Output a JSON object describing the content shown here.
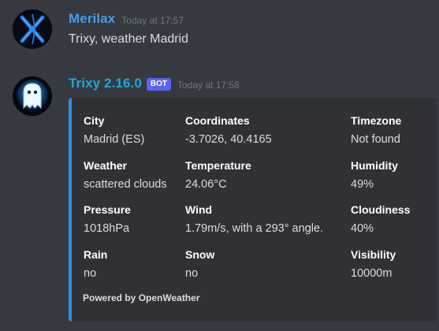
{
  "messages": [
    {
      "author": "Merilax",
      "author_color": "#4d9ae6",
      "timestamp": "Today at 17:57",
      "content": "Trixy, weather Madrid"
    },
    {
      "author": "Trixy 2.16.0",
      "author_color": "#1fa9d6",
      "badge": "BOT",
      "timestamp": "Today at 17:58",
      "embed": {
        "accent_color": "#2f8ee0",
        "fields": [
          {
            "name": "City",
            "value": "Madrid (ES)"
          },
          {
            "name": "Coordinates",
            "value": "-3.7026, 40.4165"
          },
          {
            "name": "Timezone",
            "value": "Not found"
          },
          {
            "name": "Weather",
            "value": "scattered clouds"
          },
          {
            "name": "Temperature",
            "value": "24.06°C"
          },
          {
            "name": "Humidity",
            "value": "49%"
          },
          {
            "name": "Pressure",
            "value": "1018hPa"
          },
          {
            "name": "Wind",
            "value": "1.79m/s, with a 293° angle."
          },
          {
            "name": "Cloudiness",
            "value": "40%"
          },
          {
            "name": "Rain",
            "value": "no"
          },
          {
            "name": "Snow",
            "value": "no"
          },
          {
            "name": "Visibility",
            "value": "10000m"
          }
        ],
        "footer": "Powered by OpenWeather"
      }
    }
  ]
}
